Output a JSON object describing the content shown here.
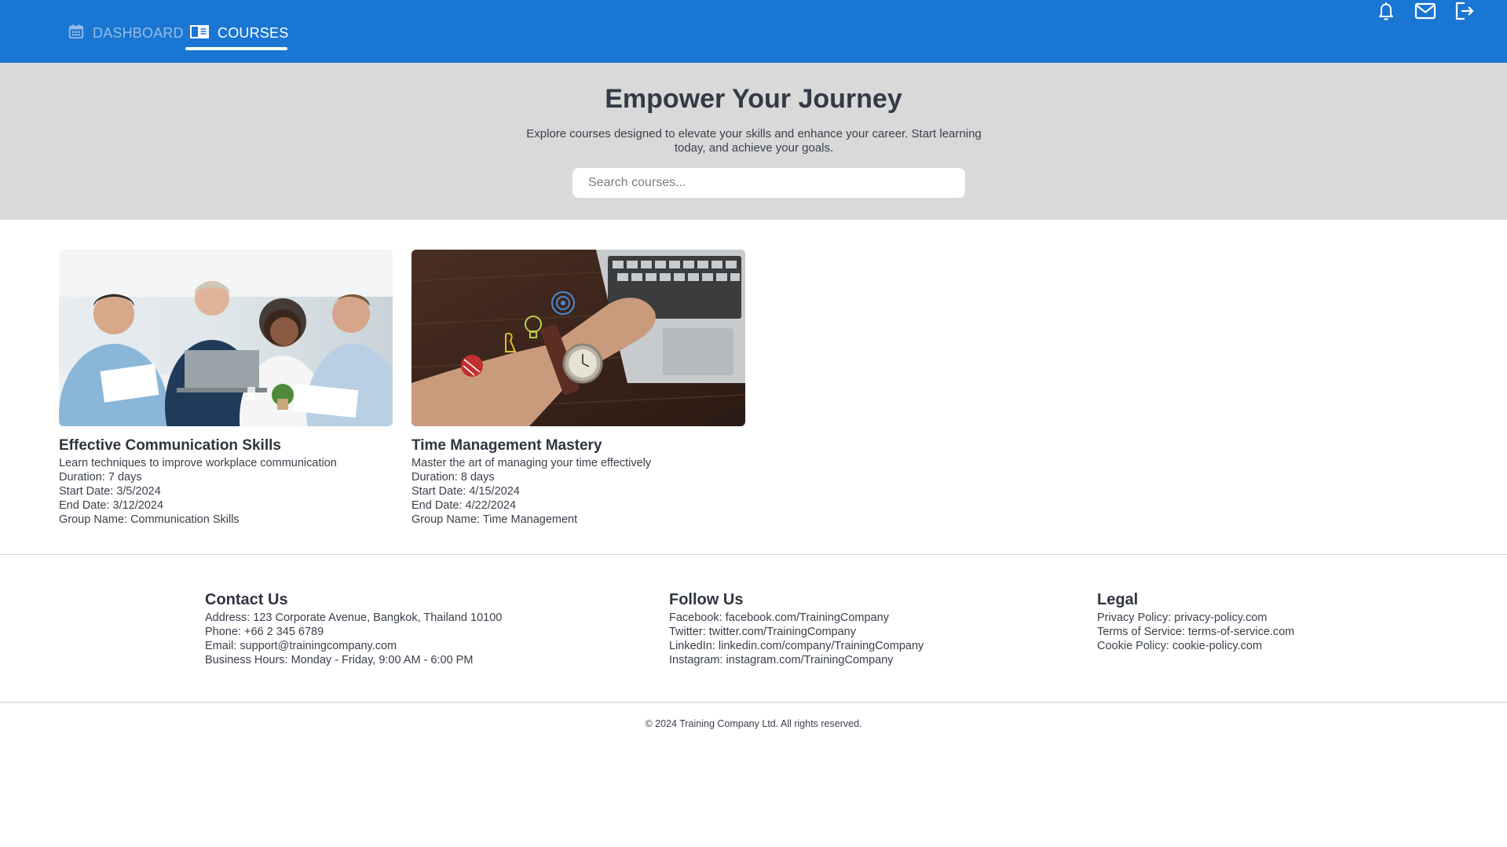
{
  "nav": {
    "tabs": [
      {
        "label": "DASHBOARD",
        "icon": "calendar-icon",
        "active": false
      },
      {
        "label": "COURSES",
        "icon": "book-icon",
        "active": true
      }
    ],
    "actions": [
      {
        "icon": "bell-icon"
      },
      {
        "icon": "mail-icon"
      },
      {
        "icon": "logout-icon"
      }
    ],
    "colors": {
      "bar": "#1976d2",
      "inactive": "#93bde6",
      "active": "#ffffff"
    }
  },
  "hero": {
    "title": "Empower Your Journey",
    "subtitle": "Explore courses designed to elevate your skills and enhance your career. Start learning today, and achieve your goals.",
    "search_placeholder": "Search courses..."
  },
  "courses": [
    {
      "title": "Effective Communication Skills",
      "description": "Learn techniques to improve workplace communication",
      "duration": "Duration: 7 days",
      "start_date": "Start Date: 3/5/2024",
      "end_date": "End Date: 3/12/2024",
      "group_name": "Group Name: Communication Skills"
    },
    {
      "title": "Time Management Mastery",
      "description": "Master the art of managing your time effectively",
      "duration": "Duration: 8 days",
      "start_date": "Start Date: 4/15/2024",
      "end_date": "End Date: 4/22/2024",
      "group_name": "Group Name: Time Management"
    }
  ],
  "footer": {
    "contact": {
      "heading": "Contact Us",
      "lines": [
        "Address: 123 Corporate Avenue, Bangkok, Thailand 10100",
        "Phone: +66 2 345 6789",
        "Email: support@trainingcompany.com",
        "Business Hours: Monday - Friday, 9:00 AM - 6:00 PM"
      ]
    },
    "follow": {
      "heading": "Follow Us",
      "lines": [
        "Facebook: facebook.com/TrainingCompany",
        "Twitter: twitter.com/TrainingCompany",
        "LinkedIn: linkedin.com/company/TrainingCompany",
        "Instagram: instagram.com/TrainingCompany"
      ]
    },
    "legal": {
      "heading": "Legal",
      "lines": [
        "Privacy Policy: privacy-policy.com",
        "Terms of Service: terms-of-service.com",
        "Cookie Policy: cookie-policy.com"
      ]
    },
    "copyright": "© 2024 Training Company Ltd. All rights reserved."
  }
}
